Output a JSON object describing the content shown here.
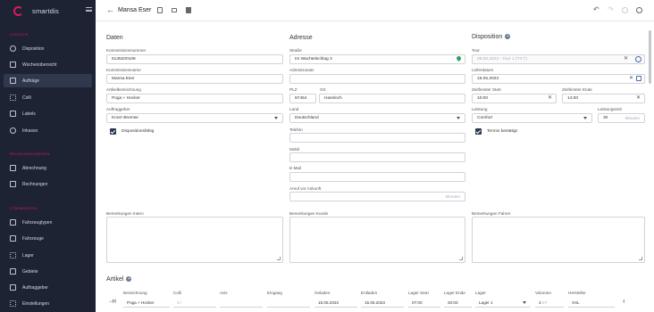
{
  "sidebar": {
    "brand": "smartdis",
    "sections": [
      {
        "title": "LOGISTIK",
        "items": [
          {
            "label": "Disposition",
            "active": false
          },
          {
            "label": "Wochenübersicht",
            "active": false
          },
          {
            "label": "Aufträge",
            "active": true
          },
          {
            "label": "Colli",
            "active": false
          },
          {
            "label": "Labels",
            "active": false
          },
          {
            "label": "Inkasso",
            "active": false
          }
        ]
      },
      {
        "title": "RECHNUNGSWESEN",
        "items": [
          {
            "label": "Abrechnung",
            "active": false
          },
          {
            "label": "Rechnungen",
            "active": false
          }
        ]
      },
      {
        "title": "STAMMDATEN",
        "items": [
          {
            "label": "Fahrzeugtypen",
            "active": false
          },
          {
            "label": "Fahrzeuge",
            "active": false
          },
          {
            "label": "Lager",
            "active": false
          },
          {
            "label": "Gebiete",
            "active": false
          },
          {
            "label": "Auftraggeber",
            "active": false
          },
          {
            "label": "Einstellungen",
            "active": false
          }
        ]
      }
    ]
  },
  "header": {
    "title": "Mansa Eser",
    "icons": [
      "back-arrow-icon",
      "copy-icon",
      "print-icon",
      "trash-icon",
      "undo-icon",
      "redo-icon",
      "search-icon",
      "user-icon"
    ]
  },
  "daten": {
    "title": "Daten",
    "kommissionsnummer": {
      "label": "Kommissionsnummer",
      "value": "6135200108"
    },
    "kommissionsname": {
      "label": "Kommissionsname",
      "value": "Mansa Eser"
    },
    "artikelbezeichnung": {
      "label": "Artikelbezeichnung",
      "value": "Poga + Hocker"
    },
    "auftraggeber": {
      "label": "Auftraggeber",
      "value": "Knorr-Bremse"
    },
    "dispositionsfaehig": {
      "label": "Dispositionsfähig",
      "checked": true
    },
    "bemerkungen_intern": {
      "label": "Bemerkungen Intern",
      "value": ""
    }
  },
  "adresse": {
    "title": "Adresse",
    "strasse": {
      "label": "Straße",
      "value": "Im Wachtelschlag 3"
    },
    "adresszusatz": {
      "label": "Adresszusatz",
      "value": ""
    },
    "plz": {
      "label": "PLZ",
      "value": "67454"
    },
    "ort": {
      "label": "Ort",
      "value": "Hassloch"
    },
    "land": {
      "label": "Land",
      "value": "Deutschland"
    },
    "telefon": {
      "label": "Telefon",
      "value": ""
    },
    "mobil": {
      "label": "Mobil",
      "value": ""
    },
    "email": {
      "label": "E-Mail",
      "value": ""
    },
    "anruf": {
      "label": "Anruf vor Ankunft",
      "value": "",
      "suffix": "Minuten"
    },
    "bemerkungen_kunde": {
      "label": "Bemerkungen Kunde",
      "value": ""
    }
  },
  "disposition": {
    "title": "Disposition",
    "tour": {
      "label": "Tour",
      "value": "09.06.2023 - Tour 1 (T3 T)"
    },
    "lieferdatum": {
      "label": "Lieferdatum",
      "value": "15.05.2023"
    },
    "zeitfenster_start": {
      "label": "Zeitfenster Start",
      "value": "10:00"
    },
    "zeitfenster_ende": {
      "label": "Zeitfenster Ende",
      "value": "14:00"
    },
    "leistung": {
      "label": "Leistung",
      "value": "Comfort"
    },
    "leistungszeit": {
      "label": "Leistungszeit",
      "value": "30",
      "suffix": "Minuten"
    },
    "termin_bestaetigt": {
      "label": "Termin bestätigt",
      "checked": true
    },
    "bemerkungen_fahrer": {
      "label": "Bemerkungen Fahrer",
      "value": ""
    }
  },
  "artikel": {
    "title": "Artikel",
    "columns": [
      "Bezeichnung",
      "Colli",
      "Avis",
      "Eingang",
      "Geladen",
      "Entladen",
      "Lager Start",
      "Lager Ende",
      "Lager",
      "Volumen",
      "Hersteller"
    ],
    "row": {
      "bezeichnung": "Poga + Hocker",
      "colli": "3 /",
      "avis": "",
      "eingang": "",
      "geladen": "15.05.2023",
      "entladen": "15.05.2023",
      "lager_start": "07:00",
      "lager_ende": "20:00",
      "lager": "Lager 1",
      "volumen": "3",
      "volumen_unit": "m³",
      "hersteller": "XXL"
    }
  }
}
